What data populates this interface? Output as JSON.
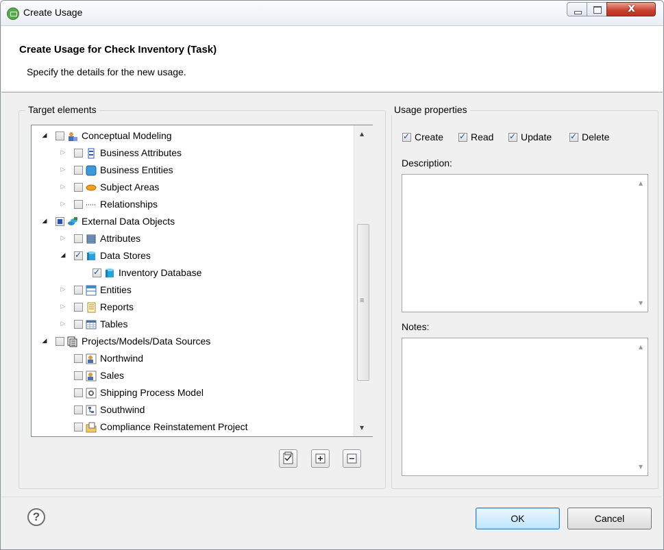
{
  "window": {
    "title": "Create Usage"
  },
  "header": {
    "title": "Create Usage for Check Inventory (Task)",
    "subtitle": "Specify the details for the new usage."
  },
  "target": {
    "group_label": "Target elements",
    "tree": [
      {
        "label": "Conceptual Modeling",
        "expander": "open",
        "check": "unchecked",
        "icon": "conceptual-modeling-icon"
      },
      {
        "label": "Business Attributes",
        "expander": "closed",
        "check": "unchecked",
        "icon": "business-attribute-icon"
      },
      {
        "label": "Business Entities",
        "expander": "closed",
        "check": "unchecked",
        "icon": "business-entity-icon"
      },
      {
        "label": "Subject Areas",
        "expander": "closed",
        "check": "unchecked",
        "icon": "subject-area-icon"
      },
      {
        "label": "Relationships",
        "expander": "closed",
        "check": "unchecked",
        "icon": "relationship-icon"
      },
      {
        "label": "External Data Objects",
        "expander": "open",
        "check": "partial",
        "icon": "external-data-objects-icon"
      },
      {
        "label": "Attributes",
        "expander": "closed",
        "check": "unchecked",
        "icon": "attribute-icon"
      },
      {
        "label": "Data Stores",
        "expander": "open",
        "check": "checked",
        "icon": "data-store-icon"
      },
      {
        "label": "Inventory Database",
        "expander": "none",
        "check": "checked",
        "icon": "database-icon"
      },
      {
        "label": "Entities",
        "expander": "closed",
        "check": "unchecked",
        "icon": "entity-icon"
      },
      {
        "label": "Reports",
        "expander": "closed",
        "check": "unchecked",
        "icon": "report-icon"
      },
      {
        "label": "Tables",
        "expander": "closed",
        "check": "unchecked",
        "icon": "table-icon"
      },
      {
        "label": "Projects/Models/Data Sources",
        "expander": "open",
        "check": "unchecked",
        "icon": "projects-icon"
      },
      {
        "label": "Northwind",
        "expander": "none",
        "check": "unchecked",
        "icon": "conceptual-model-icon"
      },
      {
        "label": "Sales",
        "expander": "none",
        "check": "unchecked",
        "icon": "conceptual-model-icon"
      },
      {
        "label": "Shipping Process Model",
        "expander": "none",
        "check": "unchecked",
        "icon": "process-model-icon"
      },
      {
        "label": "Southwind",
        "expander": "none",
        "check": "unchecked",
        "icon": "data-model-icon"
      },
      {
        "label": "Compliance Reinstatement Project",
        "expander": "none",
        "check": "unchecked",
        "icon": "project-folder-icon"
      }
    ],
    "toolbar": [
      "select-all-icon",
      "expand-all-icon",
      "collapse-all-icon"
    ]
  },
  "usage": {
    "group_label": "Usage properties",
    "crud": [
      {
        "label": "Create",
        "checked": true
      },
      {
        "label": "Read",
        "checked": true
      },
      {
        "label": "Update",
        "checked": true
      },
      {
        "label": "Delete",
        "checked": true
      }
    ],
    "description_label": "Description:",
    "description_value": "",
    "notes_label": "Notes:",
    "notes_value": ""
  },
  "footer": {
    "ok": "OK",
    "cancel": "Cancel",
    "help_glyph": "?"
  }
}
